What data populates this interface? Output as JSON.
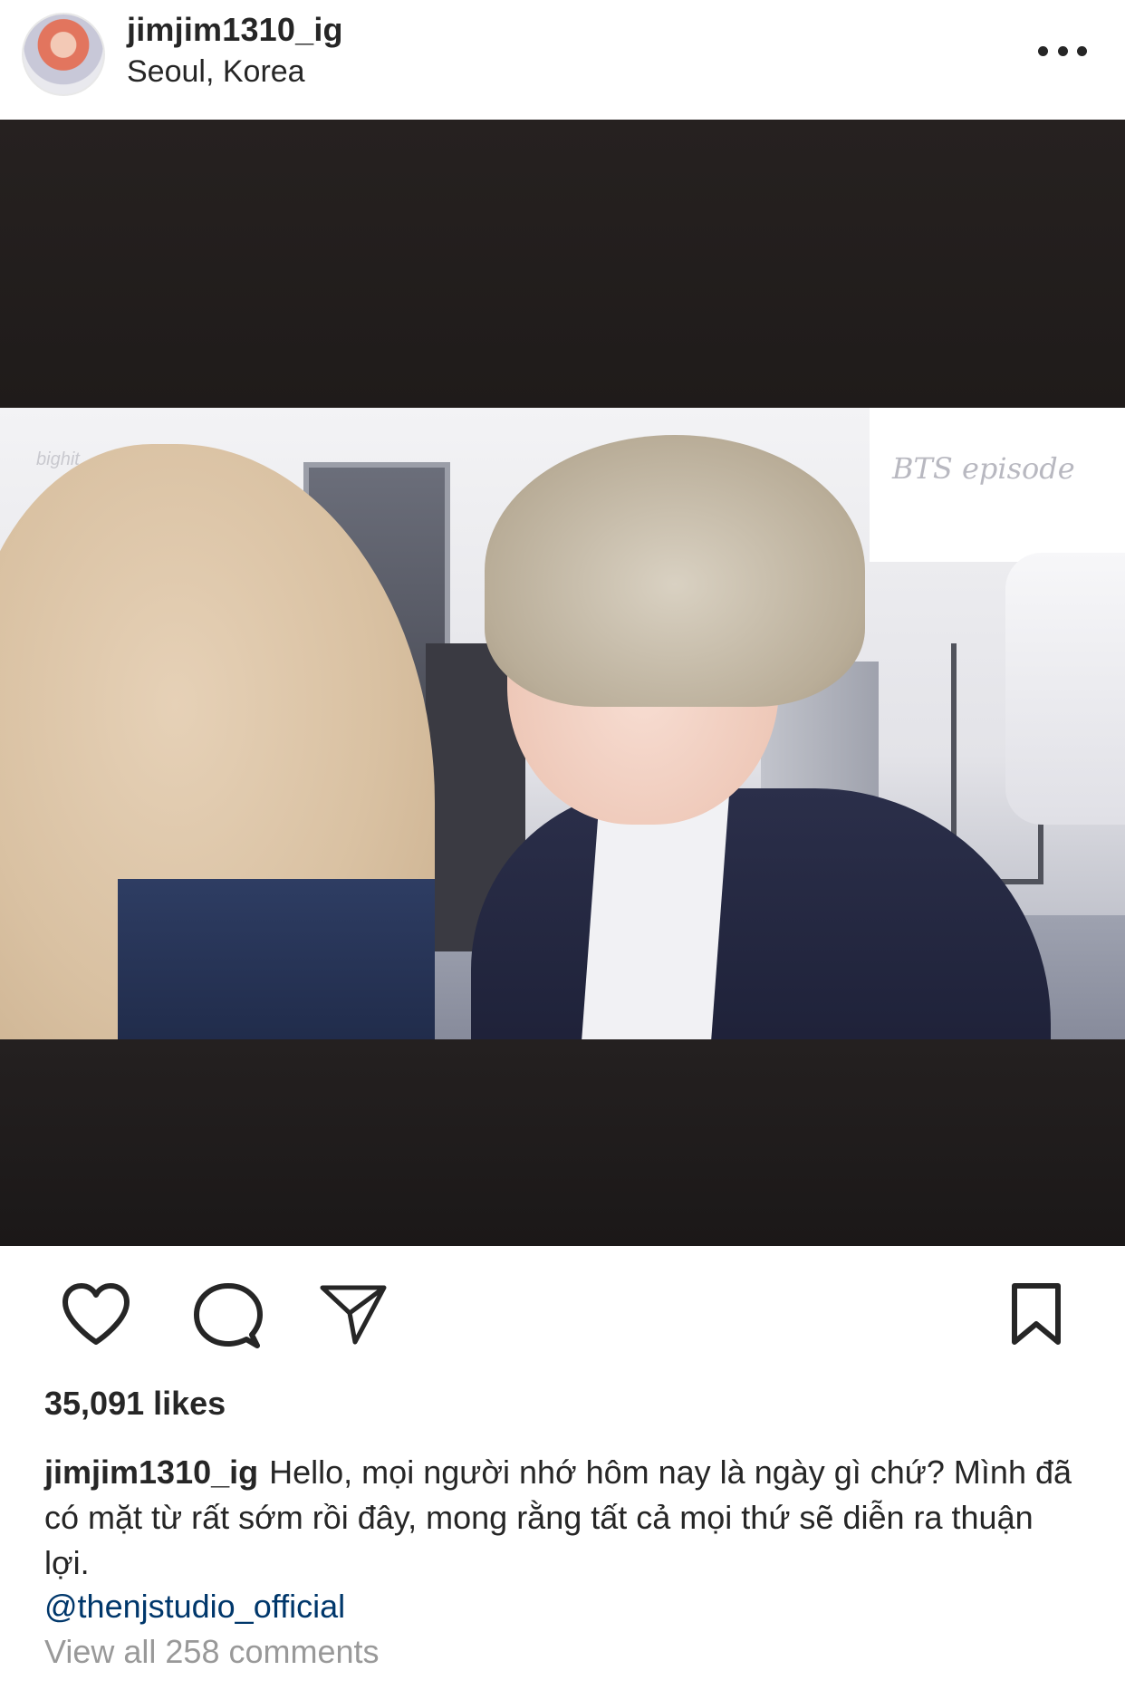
{
  "post": {
    "username": "jimjim1310_ig",
    "location": "Seoul, Korea",
    "media": {
      "watermark": "bighit",
      "sign_text": "BTS episode"
    },
    "likes_text": "35,091 likes",
    "caption": {
      "username": "jimjim1310_ig",
      "text": "Hello, mọi người nhớ hôm nay là ngày gì chứ? Mình đã có mặt từ rất sớm rồi đây, mong rằng tất cả mọi thứ sẽ diễn ra thuận lợi."
    },
    "mention": "@thenjstudio_official",
    "view_comments": "View all 258 comments"
  },
  "icons": {
    "more": "more-options-icon",
    "like": "heart-icon",
    "comment": "comment-icon",
    "share": "paper-plane-icon",
    "save": "bookmark-icon"
  },
  "colors": {
    "text": "#262626",
    "link": "#00376b",
    "muted": "#999999",
    "media_background": "#221d1b"
  }
}
